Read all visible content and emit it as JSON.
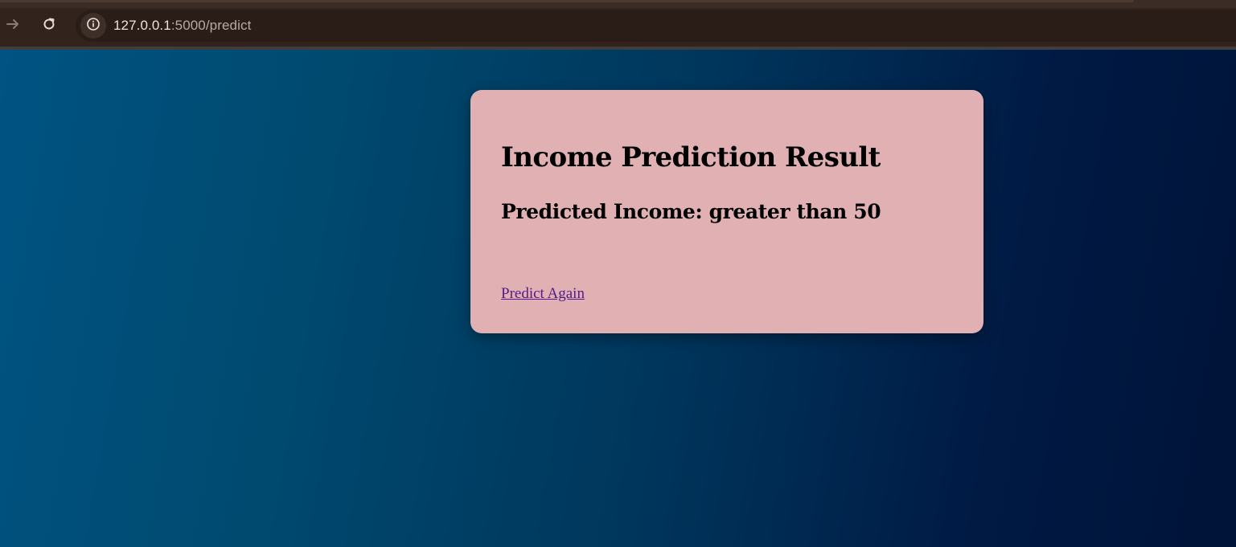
{
  "browser": {
    "url_host": "127.0.0.1",
    "url_path": ":5000/predict",
    "forward_icon": "arrow-right-icon",
    "reload_icon": "reload-icon",
    "site_info_icon": "info-icon"
  },
  "page": {
    "title": "Income Prediction Result",
    "result_text": "Predicted Income: greater than 50",
    "predict_again_link": "Predict Again"
  },
  "colors": {
    "card_background": "#e0b0b3",
    "link_visited": "#551a8b",
    "gradient_start": "#005382",
    "gradient_end": "#001338"
  }
}
